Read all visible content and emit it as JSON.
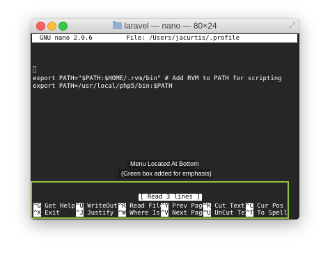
{
  "window": {
    "title": "laravel — nano — 80×24",
    "folder_icon": "folder-icon",
    "traffic_lights": [
      "close-button",
      "minimize-button",
      "zoom-button"
    ],
    "colors": {
      "close": "#fc605b",
      "minimize": "#fdbc40",
      "zoom": "#34c84a"
    }
  },
  "nano": {
    "header": "  GNU nano 2.0.6         File: /Users/jacurtis/.profile",
    "lines": [
      "export PATH=\"$PATH:$HOME/.rvm/bin\" # Add RVM to PATH for scripting",
      "export PATH=/usr/local/php5/bin:$PATH"
    ],
    "status": "[ Read 3 lines ]",
    "shortcuts_row1": [
      {
        "key": "^G",
        "label": "Get Help"
      },
      {
        "key": "^O",
        "label": "WriteOut"
      },
      {
        "key": "^R",
        "label": "Read File"
      },
      {
        "key": "^Y",
        "label": "Prev Page"
      },
      {
        "key": "^K",
        "label": "Cut Text"
      },
      {
        "key": "^C",
        "label": "Cur Pos"
      }
    ],
    "shortcuts_row2": [
      {
        "key": "^X",
        "label": "Exit"
      },
      {
        "key": "^J",
        "label": "Justify"
      },
      {
        "key": "^W",
        "label": "Where Is"
      },
      {
        "key": "^V",
        "label": "Next Page"
      },
      {
        "key": "^U",
        "label": "UnCut Text"
      },
      {
        "key": "^T",
        "label": "To Spell"
      }
    ]
  },
  "annotation": {
    "line1": "Menu Located At Bottom",
    "line2": "(Green box added for emphasis)",
    "box_color": "#8dc63f"
  }
}
